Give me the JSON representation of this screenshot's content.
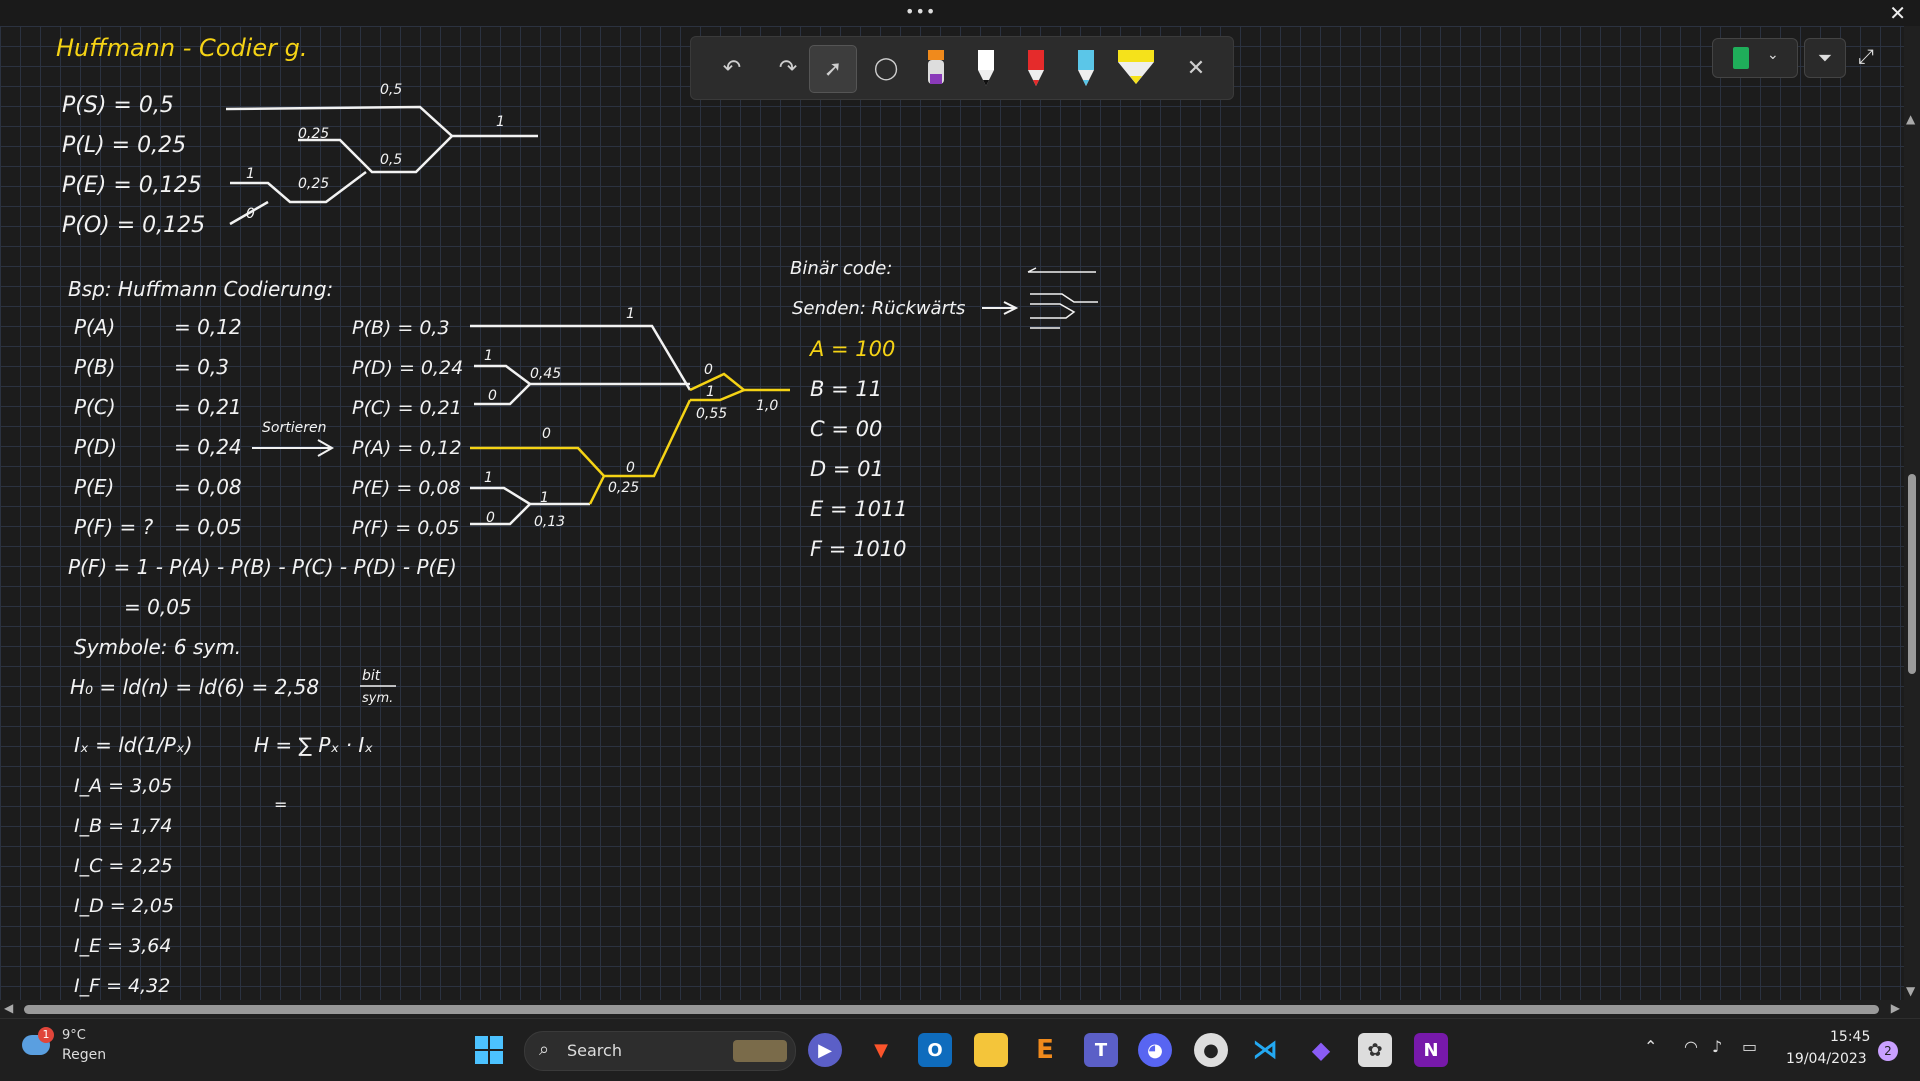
{
  "window": {
    "more_label": "•••",
    "close_label": "✕"
  },
  "toolbar": {
    "tools": [
      "undo-icon",
      "redo-icon",
      "select-icon",
      "lasso-icon",
      "highlighter-orange-purple",
      "pen-white",
      "pen-red",
      "pen-cyan",
      "highlighter-yellow",
      "close-icon"
    ],
    "close_label": "✕"
  },
  "notes": {
    "title": "Huffmann - Codier g.",
    "probs1": [
      "P(S) = 0,5",
      "P(L) = 0,25",
      "P(E) = 0,125",
      "P(O) = 0,125"
    ],
    "tree1_labels": [
      "0,5",
      "1",
      "0,25",
      "0,5",
      "1",
      "0,25",
      "0"
    ],
    "example_heading": "Bsp: Huffmann Codierung:",
    "probs2_left": [
      "P(A)",
      "P(B)",
      "P(C)",
      "P(D)",
      "P(E)",
      "P(F) = ?"
    ],
    "probs2_values": [
      "= 0,12",
      "= 0,3",
      "= 0,21",
      "= 0,24",
      "= 0,08",
      "= 0,05"
    ],
    "sort_label": "Sortieren",
    "probs2_sorted": [
      "P(B) = 0,3",
      "P(D) = 0,24",
      "P(C) = 0,21",
      "P(A) = 0,12",
      "P(E) = 0,08",
      "P(F) = 0,05"
    ],
    "tree2_labels": [
      "1",
      "1",
      "0",
      "0,45",
      "0",
      "1",
      "0,55",
      "1,0",
      "0",
      "0",
      "0,25",
      "1",
      "1",
      "0",
      "0,13"
    ],
    "pf_formula": "P(F) = 1 - P(A) - P(B) - P(C) - P(D) - P(E)",
    "pf_result": "= 0,05",
    "symbols_line": "Symbole: 6 sym.",
    "h0_line": "H₀ = ld(n) = ld(6) = 2,58",
    "bit_label": "bit",
    "sym_label": "sym.",
    "ix_formula": "Iₓ = ld(1/Pₓ)",
    "h_formula": "H = ∑ Pₓ · Iₓ",
    "h_eq": "=",
    "info_values": [
      "I_A = 3,05",
      "I_B = 1,74",
      "I_C = 2,25",
      "I_D = 2,05",
      "I_E = 3,64",
      "I_F = 4,32"
    ],
    "binary_heading": "Binär code:",
    "send_line": "Senden: Rückwärts",
    "codes": [
      "A = 100",
      "B = 11",
      "C = 00",
      "D = 01",
      "E = 1011",
      "F = 1010"
    ]
  },
  "taskbar": {
    "weather_temp": "9°C",
    "weather_desc": "Regen",
    "weather_badge": "1",
    "search_placeholder": "Search",
    "apps": [
      "windows-start-icon",
      "zoom-icon",
      "brave-icon",
      "outlook-icon",
      "file-explorer-icon",
      "e-app-icon",
      "teams-icon",
      "discord-icon",
      "github-icon",
      "vscode-icon",
      "obsidian-icon",
      "settings-app-icon",
      "onenote-icon"
    ],
    "clock_time": "15:45",
    "clock_date": "19/04/2023",
    "notification_count": "2"
  },
  "colors": {
    "ink": "#f2f2f2",
    "highlight": "#f5d315",
    "grid": "#2b3240",
    "background": "#1c1c1c"
  }
}
